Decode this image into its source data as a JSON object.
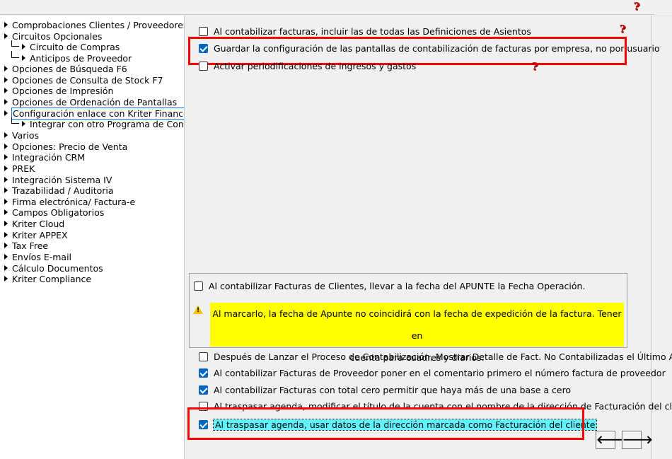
{
  "help_icon_glyph": "?",
  "tree": {
    "items": [
      {
        "label": "Comprobaciones Clientes / Proveedores"
      },
      {
        "label": "Circuitos Opcionales"
      },
      {
        "label": "Circuito de Compras"
      },
      {
        "label": "Anticipos de Proveedor"
      },
      {
        "label": "Opciones de Búsqueda F6"
      },
      {
        "label": "Opciones de Consulta de Stock F7"
      },
      {
        "label": "Opciones de Impresión"
      },
      {
        "label": "Opciones de Ordenación de Pantallas"
      },
      {
        "label": "Configuración enlace con Kriter Finances"
      },
      {
        "label": "Integrar con otro Programa de Contabi"
      },
      {
        "label": "Varios"
      },
      {
        "label": "Opciones: Precio de Venta"
      },
      {
        "label": "Integración CRM"
      },
      {
        "label": "PREK"
      },
      {
        "label": "Integración Sistema IV"
      },
      {
        "label": "Trazabilidad / Auditoria"
      },
      {
        "label": "Firma electrónica/ Factura-e"
      },
      {
        "label": "Campos Obligatorios"
      },
      {
        "label": "Kriter Cloud"
      },
      {
        "label": "Kriter APPEX"
      },
      {
        "label": "Tax Free"
      },
      {
        "label": "Envíos E-mail"
      },
      {
        "label": "Cálculo Documentos"
      },
      {
        "label": "Kriter Compliance"
      }
    ]
  },
  "options": {
    "top": [
      {
        "label": "Al contabilizar facturas, incluir las de todas las Definiciones de Asientos",
        "checked": false
      },
      {
        "label": "Guardar la configuración de las pantallas de contabilización de facturas por empresa, no por usuario",
        "checked": true
      },
      {
        "label": "Activar periodificaciones de ingresos y gastos",
        "checked": false
      }
    ],
    "group": {
      "label": "Al contabilizar Facturas de Clientes, llevar a la fecha del APUNTE la Fecha Operación.",
      "checked": false,
      "warning_line1": "Al marcarlo, la fecha de Apunte no coincidirá con la fecha de expedición de la factura. Tener en",
      "warning_line2": "cuenta para cuadres y diarios."
    },
    "bottom": [
      {
        "label": "Después de Lanzar el Proceso de Contabilización, Mostrar Detalle de Fact. No Contabilizadas el Último Año.",
        "checked": false
      },
      {
        "label": "Al contabilizar Facturas de Proveedor poner en el comentario primero el número factura de proveedor",
        "checked": true
      },
      {
        "label": "Al contabilizar Facturas con total cero permitir que haya más de una base a cero",
        "checked": true
      },
      {
        "label": "Al traspasar agenda, modificar el título de la cuenta con el nombre de la dirección de Facturación del cliente",
        "checked": false
      },
      {
        "label": "Al traspasar agenda, usar datos de la dirección marcada como Facturación del cliente",
        "checked": true
      }
    ]
  },
  "nav": {
    "back_glyph": "🡐",
    "forward_glyph": "🡒"
  },
  "colors": {
    "accent": "#0067c0",
    "annotation_red": "#ff0000",
    "warning_yellow": "#ffff00",
    "focus_cyan": "#5ff6ff"
  }
}
